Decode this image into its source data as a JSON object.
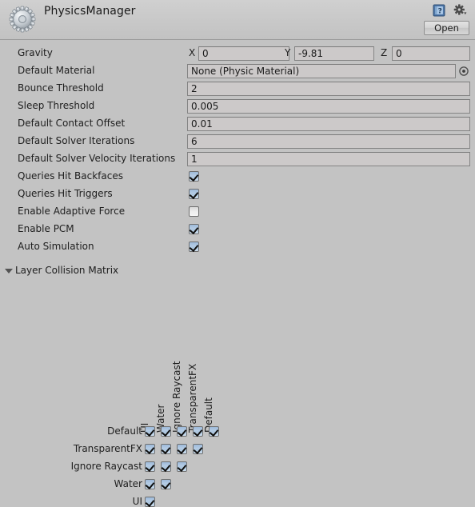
{
  "header": {
    "title": "PhysicsManager",
    "gear_icon": "gear-icon",
    "help_icon": "help-book-icon",
    "settings_icon": "settings-gear-dropdown-icon",
    "open_label": "Open"
  },
  "properties": [
    {
      "label": "Gravity",
      "type": "vector3",
      "axes": [
        {
          "letter": "X",
          "value": "0"
        },
        {
          "letter": "Y",
          "value": "-9.81"
        },
        {
          "letter": "Z",
          "value": "0"
        }
      ]
    },
    {
      "label": "Default Material",
      "type": "object",
      "value": "None (Physic Material)",
      "picker_icon": "object-picker-icon"
    },
    {
      "label": "Bounce Threshold",
      "type": "text",
      "value": "2"
    },
    {
      "label": "Sleep Threshold",
      "type": "text",
      "value": "0.005"
    },
    {
      "label": "Default Contact Offset",
      "type": "text",
      "value": "0.01"
    },
    {
      "label": "Default Solver Iterations",
      "type": "text",
      "value": "6"
    },
    {
      "label": "Default Solver Velocity Iterations",
      "type": "text",
      "value": "1",
      "clipped": true
    },
    {
      "label": "Queries Hit Backfaces",
      "type": "checkbox",
      "checked": true
    },
    {
      "label": "Queries Hit Triggers",
      "type": "checkbox",
      "checked": true
    },
    {
      "label": "Enable Adaptive Force",
      "type": "checkbox",
      "checked": false
    },
    {
      "label": "Enable PCM",
      "type": "checkbox",
      "checked": true
    },
    {
      "label": "Auto Simulation",
      "type": "checkbox",
      "checked": true
    }
  ],
  "foldout": {
    "label": "Layer Collision Matrix",
    "expanded": true,
    "triangle_icon": "chevron-down-icon"
  },
  "collision_matrix": {
    "column_labels": [
      "UI",
      "Water",
      "Ignore Raycast",
      "TransparentFX",
      "Default"
    ],
    "row_labels": [
      "Default",
      "TransparentFX",
      "Ignore Raycast",
      "Water",
      "UI"
    ],
    "rows": [
      {
        "label": "Default",
        "checks": [
          true,
          true,
          true,
          true,
          true
        ]
      },
      {
        "label": "TransparentFX",
        "checks": [
          true,
          true,
          true,
          true
        ]
      },
      {
        "label": "Ignore Raycast",
        "checks": [
          true,
          true,
          true
        ]
      },
      {
        "label": "Water",
        "checks": [
          true,
          true
        ]
      },
      {
        "label": "UI",
        "checks": [
          true
        ]
      }
    ]
  },
  "colors": {
    "background": "#c3c3c3",
    "header": "#c9c9c9",
    "field_bg": "#ccc9c9",
    "checkbox_on": "#b6cde5",
    "text": "#1b1b1b"
  }
}
